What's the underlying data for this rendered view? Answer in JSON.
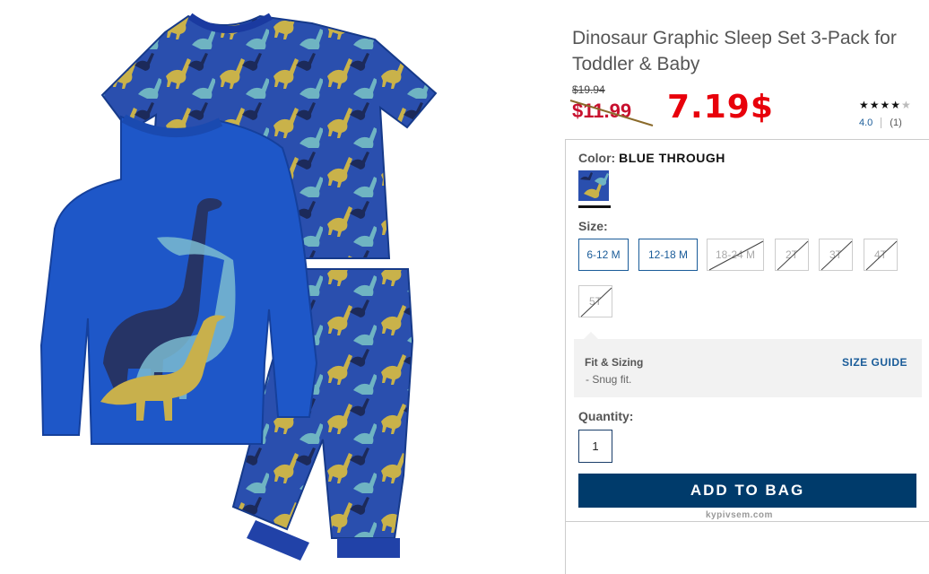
{
  "product": {
    "title": "Dinosaur Graphic Sleep Set 3-Pack for Toddler & Baby",
    "original_price": "$19.94",
    "sale_price": "$11.99",
    "promo_price": "7.19$",
    "rating": {
      "stars_filled": 4,
      "stars_total": 5,
      "value": "4.0",
      "count": "(1)"
    }
  },
  "color": {
    "label": "Color:",
    "value": "BLUE THROUGH",
    "swatch_color": "#2345a6"
  },
  "size": {
    "label": "Size:",
    "options": [
      {
        "label": "6-12 M",
        "available": true
      },
      {
        "label": "12-18 M",
        "available": true
      },
      {
        "label": "18-24 M",
        "available": false
      },
      {
        "label": "2T",
        "available": false
      },
      {
        "label": "3T",
        "available": false
      },
      {
        "label": "4T",
        "available": false
      },
      {
        "label": "5T",
        "available": false
      }
    ]
  },
  "fit": {
    "title": "Fit & Sizing",
    "note": "- Snug fit.",
    "guide_link": "SIZE GUIDE"
  },
  "quantity": {
    "label": "Quantity:",
    "value": "1"
  },
  "add_to_bag": "ADD TO BAG",
  "watermark": "kypivsem.com",
  "colors": {
    "accent": "#1a5c99",
    "button": "#003b6b",
    "sale_red": "#c8102e",
    "promo_red": "#e8000b",
    "garment_blue": "#1f4fb4"
  }
}
